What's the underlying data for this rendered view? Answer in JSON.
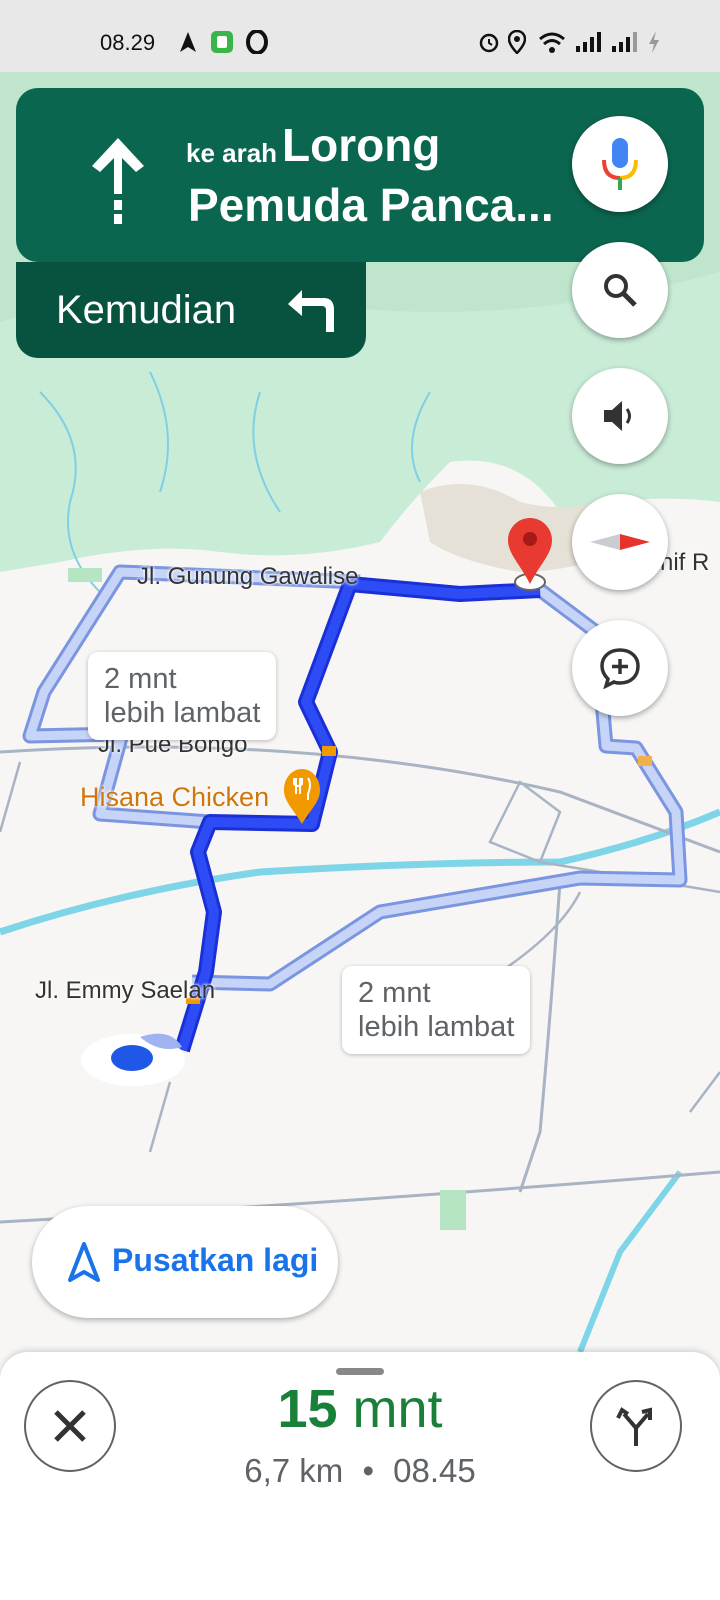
{
  "status_bar": {
    "time": "08.29"
  },
  "navigation": {
    "toward_prefix": "ke arah",
    "street_line1": "Lorong",
    "street_line2": "Pemuda Panca...",
    "then_label": "Kemudian"
  },
  "map": {
    "street_labels": [
      "Jl. Gunung Gawalise",
      "Jl. Pue Bongo",
      "Jl. Emmy Saelan",
      "nif R"
    ],
    "poi_label": "Hisana Chicken",
    "callouts": [
      {
        "line1": "2 mnt",
        "line2": "lebih lambat"
      },
      {
        "line1": "2 mnt",
        "line2": "lebih lambat"
      }
    ]
  },
  "fab_buttons": [
    "mic-icon",
    "search-icon",
    "volume-icon",
    "compass-icon",
    "add-report-icon"
  ],
  "recenter_label": "Pusatkan lagi",
  "trip": {
    "eta_value": "15",
    "eta_unit": "mnt",
    "distance": "6,7 km",
    "separator": "•",
    "arrival_time": "08.45"
  },
  "colors": {
    "nav_green": "#0b6650",
    "route_blue": "#1a3cf0",
    "eta_green": "#188038",
    "accent_blue": "#1a73e8"
  }
}
